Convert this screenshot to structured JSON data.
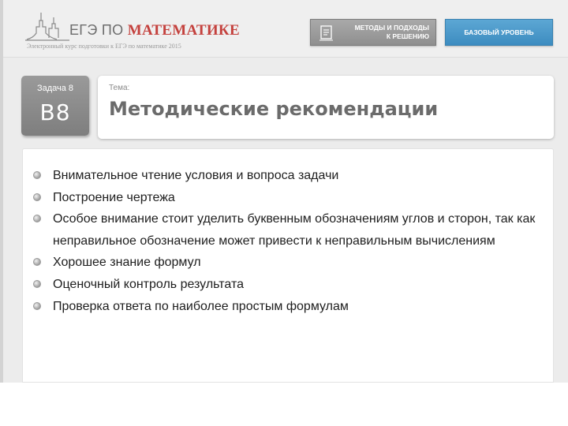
{
  "header": {
    "logo_prefix": "ЕГЭ ПО ",
    "logo_accent": "МАТЕМАТИКЕ",
    "logo_subtitle": "Электронный курс подготовки к ЕГЭ по математике 2015",
    "methods_button_line1": "МЕТОДЫ И ПОДХОДЫ",
    "methods_button_line2": "К РЕШЕНИЮ",
    "level_button": "БАЗОВЫЙ УРОВЕНЬ"
  },
  "task": {
    "label": "Задача 8",
    "code": "В8"
  },
  "theme": {
    "label": "Тема:",
    "title": "Методические рекомендации"
  },
  "content": {
    "bullets": [
      "Внимательное чтение условия и вопроса задачи",
      "Построение чертежа",
      "Особое внимание стоит уделить буквенным обозначениям углов и сторон, так как неправильное обозначение может привести к неправильным вычислениям",
      "Хорошее знание формул",
      "Оценочный контроль результата",
      "Проверка ответа по наиболее простым формулам"
    ]
  },
  "colors": {
    "accent_red": "#c4413d",
    "level_button_blue": "#4a97c9",
    "methods_button_gray": "#9b9b9b",
    "task_box_gray": "#8a8a8a"
  },
  "icons": {
    "logo": "university-building-icon",
    "methods": "document-icon",
    "bullet": "circle-bullet-icon"
  }
}
